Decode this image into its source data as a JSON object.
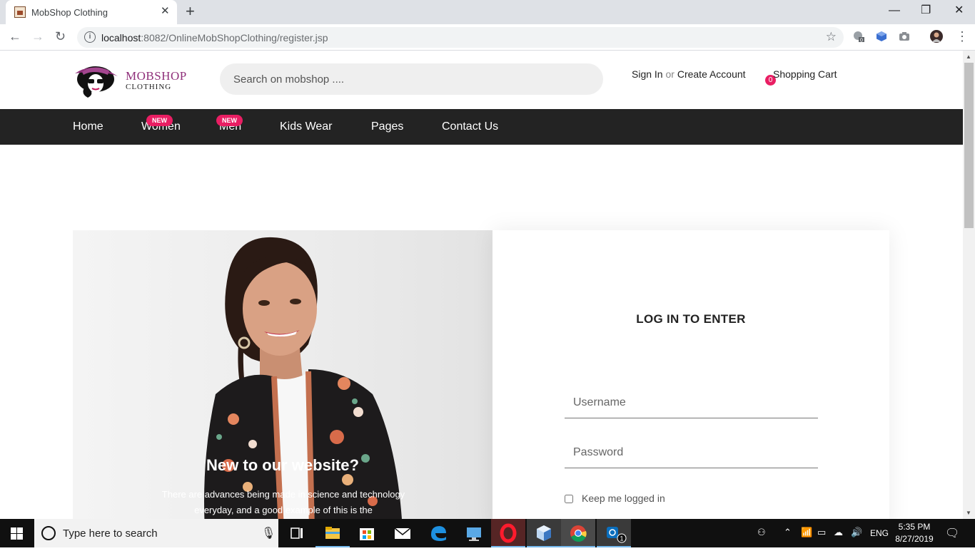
{
  "browser": {
    "tab_title": "MobShop Clothing",
    "url_host": "localhost",
    "url_rest": ":8082/OnlineMobShopClothing/register.jsp",
    "extension_badge": "0"
  },
  "header": {
    "logo_line1": "MOBSHOP",
    "logo_line2": "CLOTHING",
    "search_placeholder": "Search on mobshop ....",
    "sign_in": "Sign In",
    "or": "or",
    "create_account": "Create Account",
    "cart_count": "0",
    "cart_label": "Shopping Cart"
  },
  "nav": {
    "items": [
      {
        "label": "Home"
      },
      {
        "label": "Women",
        "badge": "NEW"
      },
      {
        "label": "Men",
        "badge": "NEW"
      },
      {
        "label": "Kids Wear"
      },
      {
        "label": "Pages"
      },
      {
        "label": "Contact Us"
      }
    ]
  },
  "hero": {
    "title": "New to our website?",
    "text": "There are advances being made in science and technology everyday, and a good example of this is the"
  },
  "login": {
    "title": "LOG IN TO ENTER",
    "username_placeholder": "Username",
    "password_placeholder": "Password",
    "remember_label": "Keep me logged in"
  },
  "taskbar": {
    "search_placeholder": "Type here to search",
    "language": "ENG",
    "time": "5:35 PM",
    "date": "8/27/2019",
    "notification_count": "1"
  },
  "colors": {
    "accent": "#e91e63",
    "brand": "#8f2f7a",
    "navbar": "#232323"
  }
}
